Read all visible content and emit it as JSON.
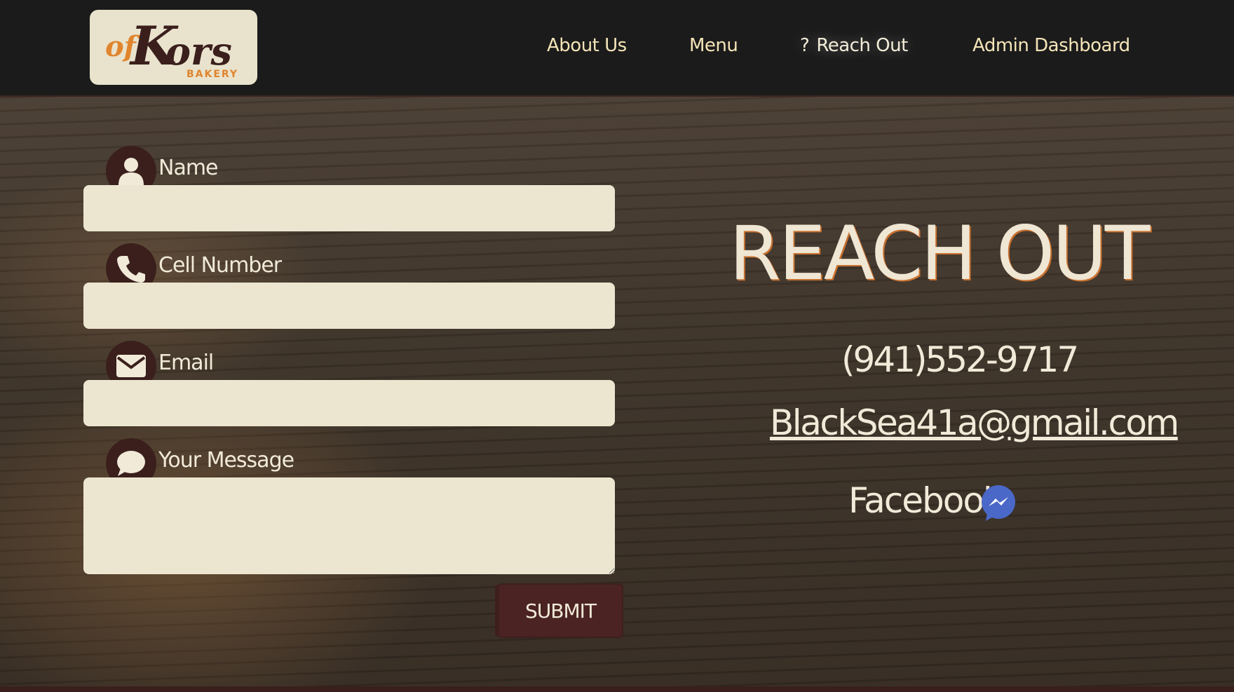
{
  "brand": {
    "logo_script": "of Kors",
    "logo_sub": "BAKERY"
  },
  "nav": {
    "items": [
      {
        "label": "About Us"
      },
      {
        "label": "Menu"
      },
      {
        "label": "Reach Out",
        "icon": "question-icon",
        "active": true
      },
      {
        "label": "Admin Dashboard"
      }
    ]
  },
  "form": {
    "fields": [
      {
        "label": "Name",
        "icon": "user-icon",
        "value": ""
      },
      {
        "label": "Cell Number",
        "icon": "phone-icon",
        "value": ""
      },
      {
        "label": "Email",
        "icon": "envelope-icon",
        "value": ""
      },
      {
        "label": "Your Message",
        "icon": "chat-bubble-icon",
        "value": ""
      }
    ],
    "submit_label": "SUBMIT"
  },
  "contact": {
    "heading": "REACH OUT",
    "phone": "(941)552-9717",
    "email": "BlackSea41a@gmail.com",
    "facebook_label": "Facebook",
    "facebook_icon": "messenger-icon"
  },
  "colors": {
    "header_bg": "#1b1b1b",
    "accent_dark": "#3a1f1c",
    "input_bg": "#ece6d0",
    "nav_text": "#f4e4b8",
    "heading_outline": "#c8702e",
    "messenger_blue": "#4a68c8"
  }
}
